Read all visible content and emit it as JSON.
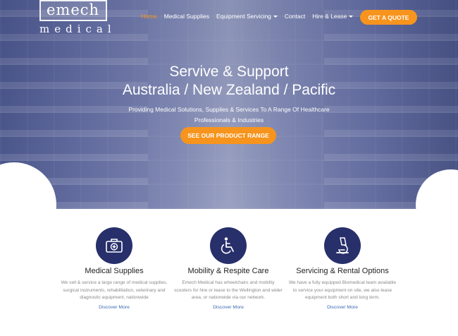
{
  "logo": {
    "top": "emech",
    "bottom": "medical"
  },
  "nav": {
    "items": [
      {
        "label": "Home"
      },
      {
        "label": "Medical Supplies"
      },
      {
        "label": "Equipment Servicing"
      },
      {
        "label": "Contact"
      },
      {
        "label": "Hire & Lease"
      }
    ],
    "quote_button": "GET A QUOTE"
  },
  "hero": {
    "title_line1": "Servive & Support",
    "title_line2": "Australia / New Zealand / Pacific",
    "subtitle": "Providing Medical Solutions, Supplies & Services To A Range Of Healthcare Professionals & Industries",
    "cta": "SEE OUR PRODUCT RANGE"
  },
  "features": [
    {
      "icon": "medical-case-icon",
      "title": "Medical Supplies",
      "text": "We sell & service a large range of medical supplies, surgical instruments, rehabilitation, veterinary and diagnostic equipment, nationwide",
      "link": "Discover More"
    },
    {
      "icon": "wheelchair-icon",
      "title": "Mobility & Respite Care",
      "text": "Emech Medical has wheelchairs and mobility scooters for hire or lease to the Wellington and wider area, or nationwide via our network.",
      "link": "Discover More"
    },
    {
      "icon": "microscope-icon",
      "title": "Servicing & Rental Options",
      "text": "We have a fully equipped Biomedical team available to service your equipment on site, we also lease equipment both short and long term.",
      "link": "Discover More"
    }
  ],
  "colors": {
    "accent": "#f7941d",
    "navy": "#27306b",
    "link": "#3b68b5"
  }
}
